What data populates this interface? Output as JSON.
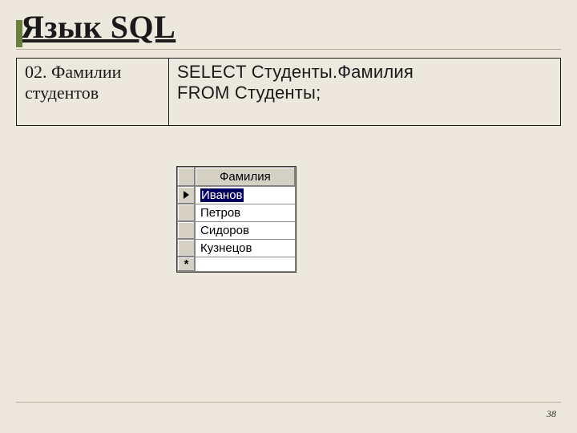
{
  "title": "Язык SQL",
  "panels": {
    "left": "02. Фамилии студентов",
    "right_line1": "SELECT Студенты.Фамилия",
    "right_line2": "FROM Студенты;"
  },
  "grid": {
    "header": "Фамилия",
    "rows": [
      "Иванов",
      "Петров",
      "Сидоров",
      "Кузнецов"
    ]
  },
  "page_number": "38"
}
